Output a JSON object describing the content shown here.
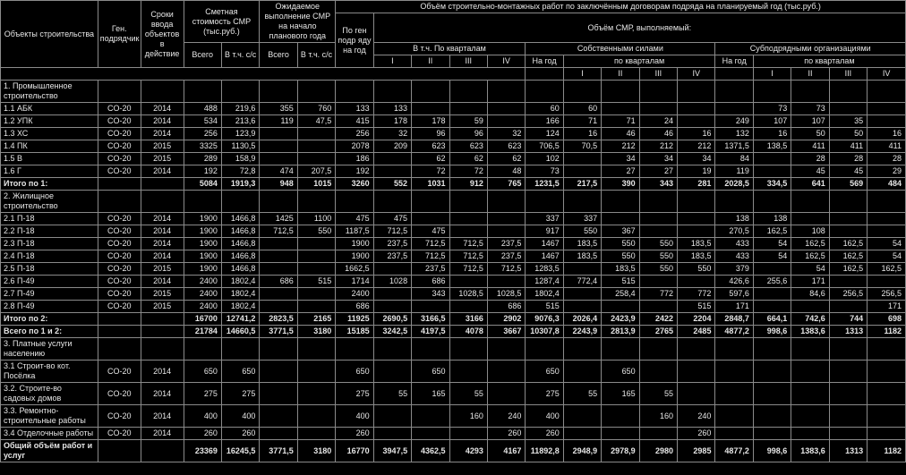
{
  "header": {
    "h1": [
      "Объекты строительства",
      "Ген. подрядчик",
      "Сроки ввода объектов в действие"
    ],
    "h2": "Сметная стоимость СМР (тыс.руб.)",
    "h3": "Ожидаемое выполнение СМР на начало планового года",
    "h4": "Объём строительно-монтажных работ по заключённым договорам подряда на планируемый год (тыс.руб.)",
    "h5": "По ген подр яду на год",
    "h6": "Объём СМР, выполняемый:",
    "h7": "В т.ч. По кварталам",
    "h8": "Собственными силами",
    "h9": "Субподрядными организациями",
    "h10": "по кварталам",
    "sub": [
      "Всего",
      "В т.ч. с/с",
      "Всего",
      "В т.ч. с/с"
    ],
    "q": [
      "I",
      "II",
      "III",
      "IV"
    ],
    "ng": "На год"
  },
  "rows": [
    {
      "lab": "1. Промышленное строительство",
      "bold": false,
      "h": 2
    },
    {
      "lab": "1.1 АБК",
      "c": [
        "CO-20",
        "2014",
        "488",
        "219,6",
        "355",
        "760",
        "133",
        "133",
        "",
        "",
        "",
        "60",
        "60",
        "",
        "",
        "",
        "",
        "73",
        "73",
        "",
        "",
        ""
      ]
    },
    {
      "lab": "1.2 УПК",
      "c": [
        "CO-20",
        "2014",
        "534",
        "213,6",
        "119",
        "47,5",
        "415",
        "178",
        "178",
        "59",
        "",
        "166",
        "71",
        "71",
        "24",
        "",
        "249",
        "107",
        "107",
        "35",
        ""
      ]
    },
    {
      "lab": "1.3 ХС",
      "c": [
        "CO-20",
        "2014",
        "256",
        "123,9",
        "",
        "",
        "256",
        "32",
        "96",
        "96",
        "32",
        "124",
        "16",
        "46",
        "46",
        "16",
        "132",
        "16",
        "50",
        "50",
        "16"
      ]
    },
    {
      "lab": "1.4 ПК",
      "c": [
        "CO-20",
        "2015",
        "3325",
        "1130,5",
        "",
        "",
        "2078",
        "209",
        "623",
        "623",
        "623",
        "706,5",
        "70,5",
        "212",
        "212",
        "212",
        "1371,5",
        "138,5",
        "411",
        "411",
        "411"
      ]
    },
    {
      "lab": "1.5 В",
      "c": [
        "CO-20",
        "2015",
        "289",
        "158,9",
        "",
        "",
        "186",
        "",
        "62",
        "62",
        "62",
        "102",
        "",
        "34",
        "34",
        "34",
        "84",
        "",
        "28",
        "28",
        "28"
      ]
    },
    {
      "lab": "1.6 Г",
      "c": [
        "CO-20",
        "2014",
        "192",
        "72,8",
        "474",
        "207,5",
        "192",
        "",
        "72",
        "72",
        "48",
        "73",
        "",
        "27",
        "27",
        "19",
        "119",
        "",
        "45",
        "45",
        "29"
      ]
    },
    {
      "lab": "Итого по 1:",
      "bold": true,
      "c": [
        "",
        "",
        "5084",
        "1919,3",
        "948",
        "1015",
        "3260",
        "552",
        "1031",
        "912",
        "765",
        "1231,5",
        "217,5",
        "390",
        "343",
        "281",
        "2028,5",
        "334,5",
        "641",
        "569",
        "484"
      ]
    },
    {
      "lab": "2. Жилищное строительство",
      "h": 2
    },
    {
      "lab": "2.1 П-18",
      "c": [
        "CO-20",
        "2014",
        "1900",
        "1466,8",
        "1425",
        "1100",
        "475",
        "475",
        "",
        "",
        "",
        "337",
        "337",
        "",
        "",
        "",
        "138",
        "138",
        "",
        "",
        ""
      ]
    },
    {
      "lab": "2.2 П-18",
      "c": [
        "CO-20",
        "2014",
        "1900",
        "1466,8",
        "712,5",
        "550",
        "1187,5",
        "712,5",
        "475",
        "",
        "",
        "917",
        "550",
        "367",
        "",
        "",
        "270,5",
        "162,5",
        "108",
        "",
        ""
      ]
    },
    {
      "lab": "2.3 П-18",
      "c": [
        "CO-20",
        "2014",
        "1900",
        "1466,8",
        "",
        "",
        "1900",
        "237,5",
        "712,5",
        "712,5",
        "237,5",
        "1467",
        "183,5",
        "550",
        "550",
        "183,5",
        "433",
        "54",
        "162,5",
        "162,5",
        "54"
      ]
    },
    {
      "lab": "2.4 П-18",
      "c": [
        "CO-20",
        "2014",
        "1900",
        "1466,8",
        "",
        "",
        "1900",
        "237,5",
        "712,5",
        "712,5",
        "237,5",
        "1467",
        "183,5",
        "550",
        "550",
        "183,5",
        "433",
        "54",
        "162,5",
        "162,5",
        "54"
      ]
    },
    {
      "lab": "2.5 П-18",
      "c": [
        "CO-20",
        "2015",
        "1900",
        "1466,8",
        "",
        "",
        "1662,5",
        "",
        "237,5",
        "712,5",
        "712,5",
        "1283,5",
        "",
        "183,5",
        "550",
        "550",
        "379",
        "",
        "54",
        "162,5",
        "162,5"
      ]
    },
    {
      "lab": "2.6 П-49",
      "c": [
        "CO-20",
        "2014",
        "2400",
        "1802,4",
        "686",
        "515",
        "1714",
        "1028",
        "686",
        "",
        "",
        "1287,4",
        "772,4",
        "515",
        "",
        "",
        "426,6",
        "255,6",
        "171",
        "",
        ""
      ]
    },
    {
      "lab": "2.7 П-49",
      "c": [
        "CO-20",
        "2015",
        "2400",
        "1802,4",
        "",
        "",
        "2400",
        "",
        "343",
        "1028,5",
        "1028,5",
        "1802,4",
        "",
        "258,4",
        "772",
        "772",
        "597,6",
        "",
        "84,6",
        "256,5",
        "256,5"
      ]
    },
    {
      "lab": "2.8 П-49",
      "c": [
        "CO-20",
        "2015",
        "2400",
        "1802,4",
        "",
        "",
        "686",
        "",
        "",
        "",
        "686",
        "515",
        "",
        "",
        "",
        "515",
        "171",
        "",
        "",
        "",
        "171"
      ]
    },
    {
      "lab": "Итого по 2:",
      "bold": true,
      "c": [
        "",
        "",
        "16700",
        "12741,2",
        "2823,5",
        "2165",
        "11925",
        "2690,5",
        "3166,5",
        "3166",
        "2902",
        "9076,3",
        "2026,4",
        "2423,9",
        "2422",
        "2204",
        "2848,7",
        "664,1",
        "742,6",
        "744",
        "698"
      ]
    },
    {
      "lab": "Всего по 1 и 2:",
      "bold": true,
      "c": [
        "",
        "",
        "21784",
        "14660,5",
        "3771,5",
        "3180",
        "15185",
        "3242,5",
        "4197,5",
        "4078",
        "3667",
        "10307,8",
        "2243,9",
        "2813,9",
        "2765",
        "2485",
        "4877,2",
        "998,6",
        "1383,6",
        "1313",
        "1182"
      ]
    },
    {
      "lab": "3. Платные услуги населению",
      "h": 2
    },
    {
      "lab": "3.1 Строит-во кот. Посёлка",
      "h": 2,
      "c": [
        "CO-20",
        "2014",
        "650",
        "650",
        "",
        "",
        "650",
        "",
        "650",
        "",
        "",
        "650",
        "",
        "650",
        "",
        "",
        "",
        "",
        "",
        "",
        ""
      ]
    },
    {
      "lab": "3.2. Строите-во садовых домов",
      "h": 2,
      "c": [
        "CO-20",
        "2014",
        "275",
        "275",
        "",
        "",
        "275",
        "55",
        "165",
        "55",
        "",
        "275",
        "55",
        "165",
        "55",
        "",
        "",
        "",
        "",
        "",
        ""
      ]
    },
    {
      "lab": "3.3. Ремонтно-строительные работы",
      "h": 2,
      "c": [
        "CO-20",
        "2014",
        "400",
        "400",
        "",
        "",
        "400",
        "",
        "",
        "160",
        "240",
        "400",
        "",
        "",
        "160",
        "240",
        "",
        "",
        "",
        "",
        ""
      ]
    },
    {
      "lab": "3.4 Отделочные работы",
      "c": [
        "CO-20",
        "2014",
        "260",
        "260",
        "",
        "",
        "260",
        "",
        "",
        "",
        "260",
        "260",
        "",
        "",
        "",
        "260",
        "",
        "",
        "",
        "",
        ""
      ]
    },
    {
      "lab": "Общий объём работ и услуг",
      "bold": true,
      "h": 2,
      "c": [
        "",
        "",
        "23369",
        "16245,5",
        "3771,5",
        "3180",
        "16770",
        "3947,5",
        "4362,5",
        "4293",
        "4167",
        "11892,8",
        "2948,9",
        "2978,9",
        "2980",
        "2985",
        "4877,2",
        "998,6",
        "1383,6",
        "1313",
        "1182"
      ]
    }
  ],
  "chart_data": {
    "type": "table",
    "title": "Объём строительно-монтажных работ по заключённым договорам подряда на планируемый год (тыс.руб.)",
    "note": "See rows[] above for full tabular data; columns = [Объект, Ген.подрядчик, Сроки ввода, Сметная стоимость Всего, Сметная стоимость В т.ч. с/с, Ожидаемое выполнение Всего, Ожидаемое выполнение В т.ч. с/с, По генподряду на год, Кварталы I-IV, Собственными силами На год + кварталы I-IV, Субподрядными На год + кварталы I-IV]"
  }
}
